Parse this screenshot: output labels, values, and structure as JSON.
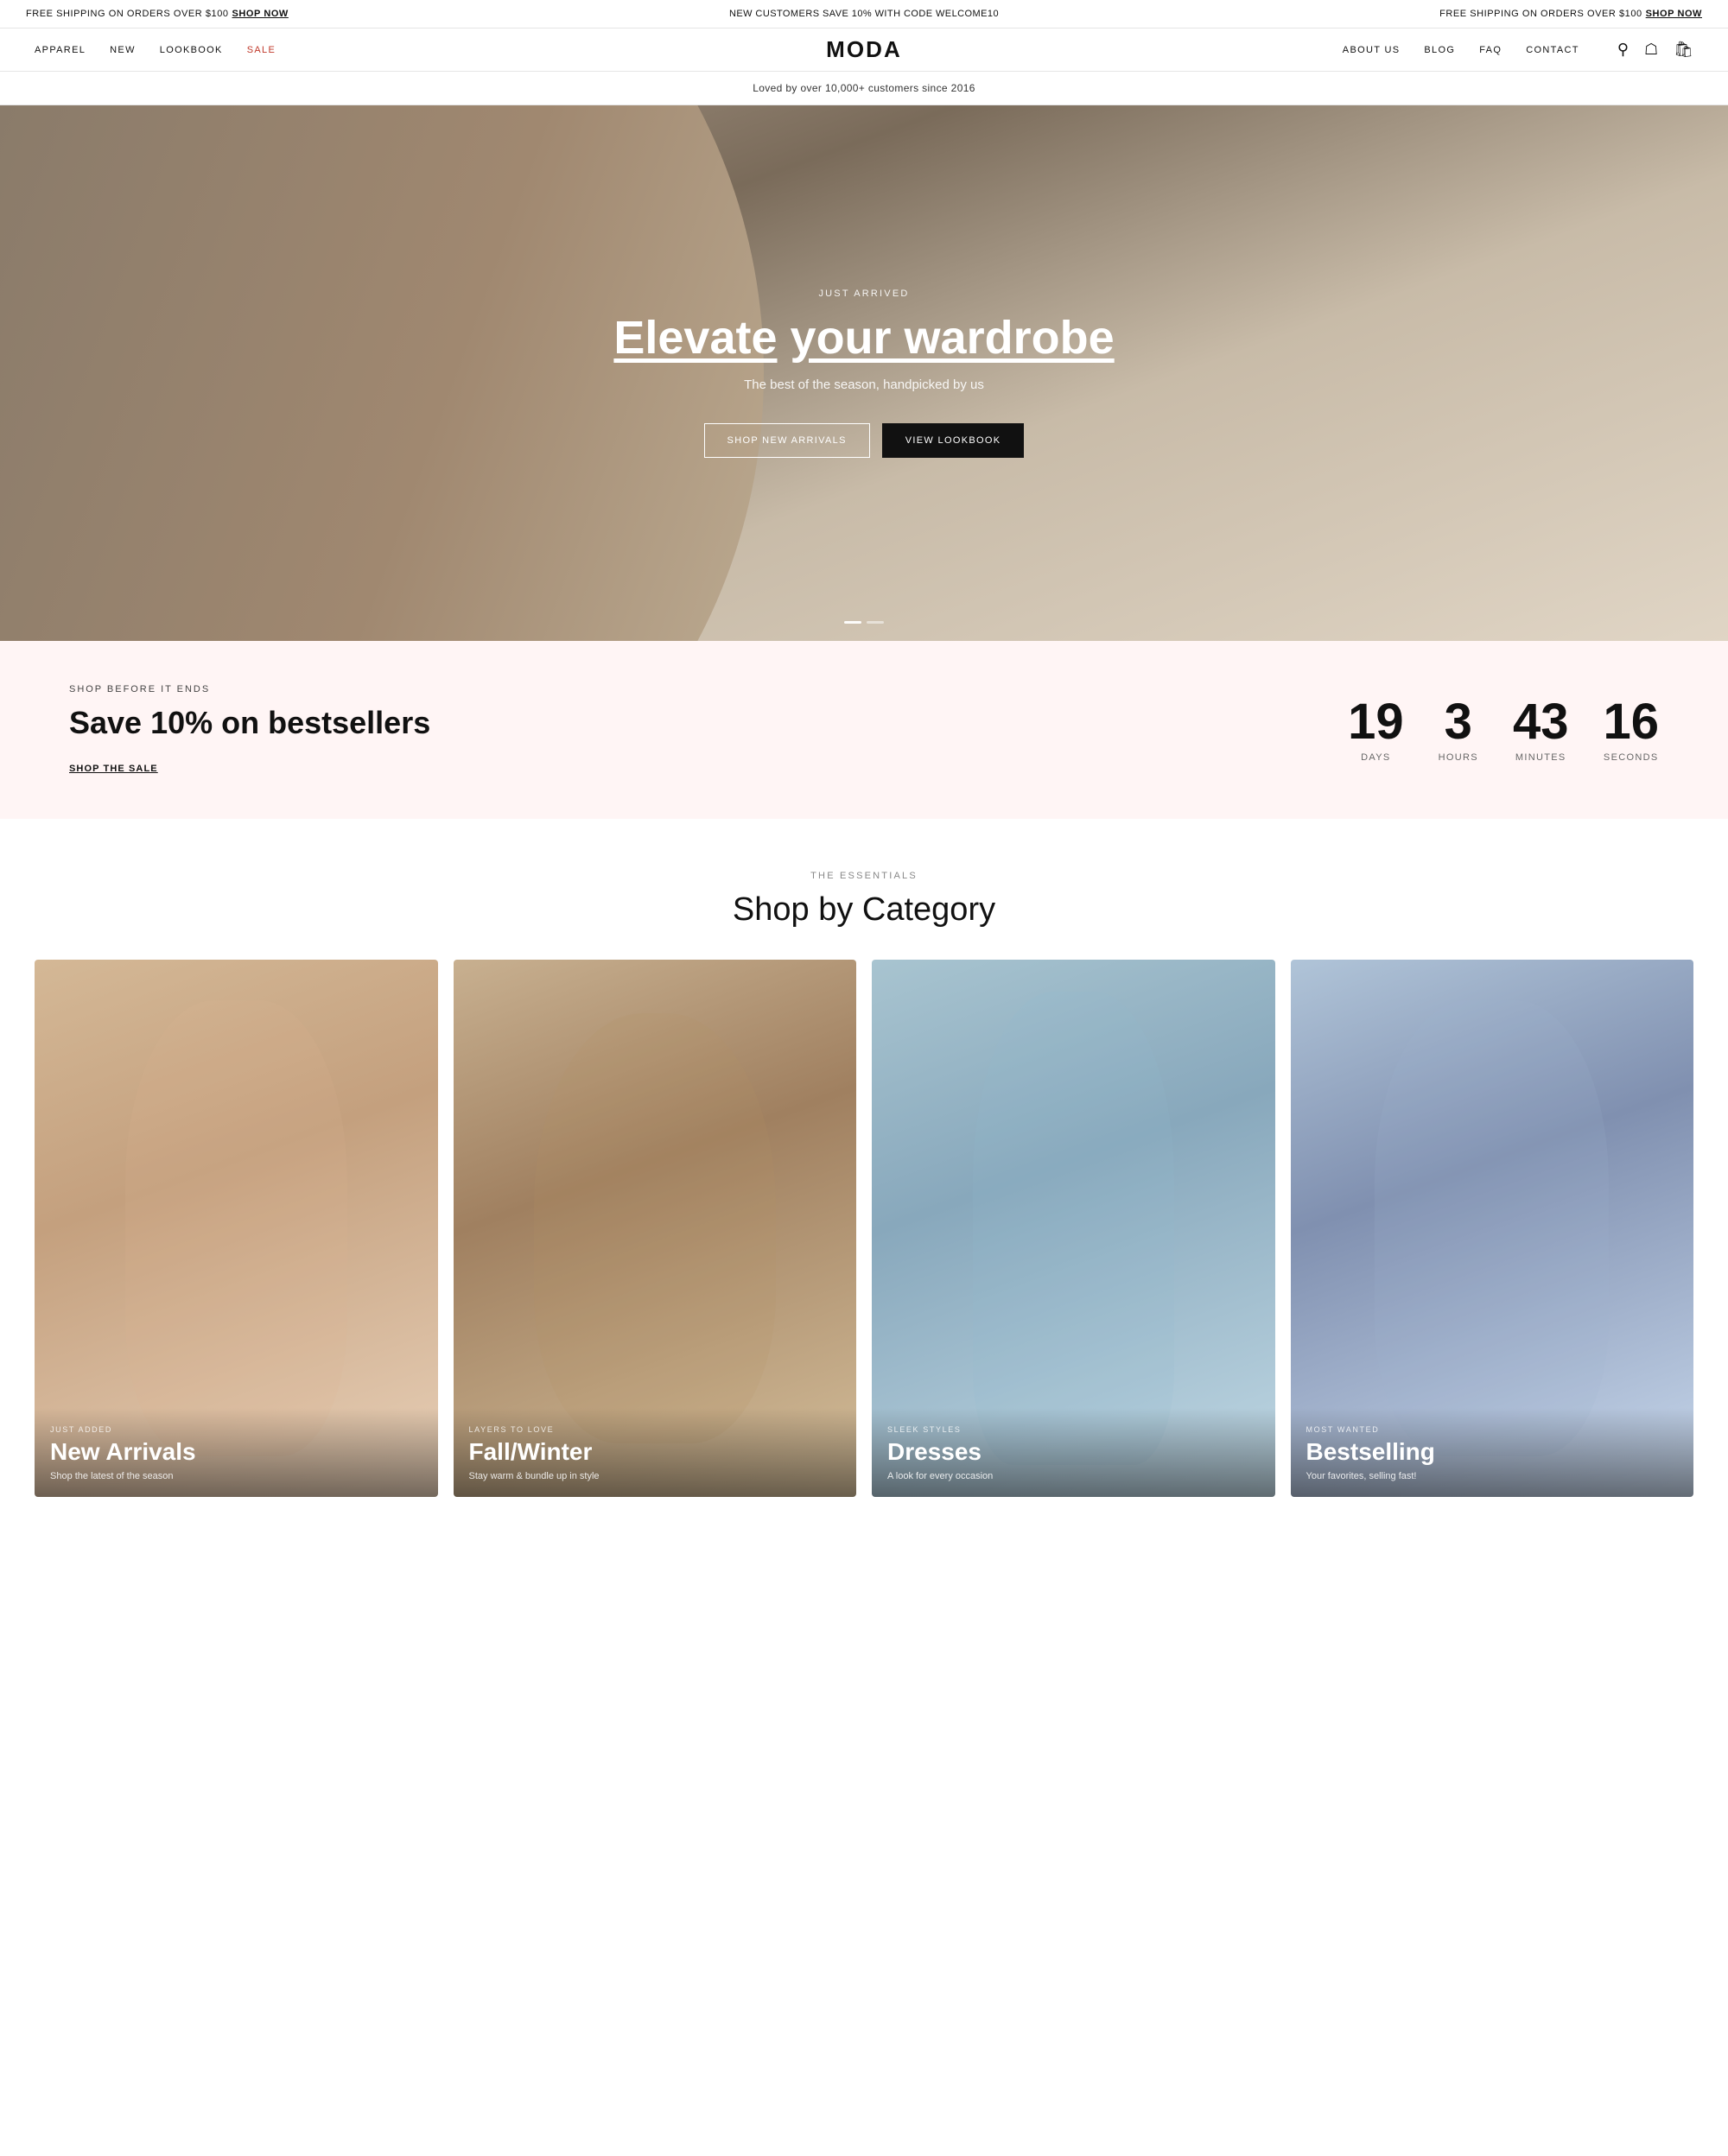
{
  "announcement": {
    "left_text": "FREE SHIPPING ON ORDERS OVER $100",
    "left_link": "SHOP NOW",
    "center_text": "NEW CUSTOMERS SAVE 10% WITH CODE WELCOME10",
    "right_text": "FREE SHIPPING ON ORDERS OVER $100",
    "right_link": "SHOP NOW"
  },
  "nav": {
    "left_items": [
      {
        "label": "APPAREL",
        "id": "apparel"
      },
      {
        "label": "NEW",
        "id": "new"
      },
      {
        "label": "LOOKBOOK",
        "id": "lookbook"
      },
      {
        "label": "SALE",
        "id": "sale",
        "accent": true
      }
    ],
    "logo": "MODA",
    "right_items": [
      {
        "label": "ABOUT US",
        "id": "about-us"
      },
      {
        "label": "BLOG",
        "id": "blog"
      },
      {
        "label": "FAQ",
        "id": "faq"
      },
      {
        "label": "CONTACT",
        "id": "contact"
      }
    ]
  },
  "trust_bar": {
    "text": "Loved by over 10,000+ customers since 2016"
  },
  "hero": {
    "eyebrow": "JUST ARRIVED",
    "title_plain": "your wardrobe",
    "title_underlined": "Elevate",
    "subtitle": "The best of the season, handpicked by us",
    "btn_primary": "SHOP NEW ARRIVALS",
    "btn_secondary": "VIEW LOOKBOOK"
  },
  "sale_banner": {
    "eyebrow": "SHOP BEFORE IT ENDS",
    "title": "Save 10% on bestsellers",
    "link_text": "SHOP THE SALE",
    "countdown": {
      "days": {
        "value": "19",
        "label": "DAYS"
      },
      "hours": {
        "value": "3",
        "label": "HOURS"
      },
      "minutes": {
        "value": "43",
        "label": "MINUTES"
      },
      "seconds": {
        "value": "16",
        "label": "SECONDS"
      }
    }
  },
  "categories": {
    "eyebrow": "THE ESSENTIALS",
    "title": "Shop by Category",
    "items": [
      {
        "tag": "JUST ADDED",
        "name": "New Arrivals",
        "desc": "Shop the latest of the season"
      },
      {
        "tag": "LAYERS TO LOVE",
        "name": "Fall/Winter",
        "desc": "Stay warm & bundle up in style"
      },
      {
        "tag": "SLEEK STYLES",
        "name": "Dresses",
        "desc": "A look for every occasion"
      },
      {
        "tag": "MOST WANTED",
        "name": "Bestselling",
        "desc": "Your favorites, selling fast!"
      }
    ]
  }
}
